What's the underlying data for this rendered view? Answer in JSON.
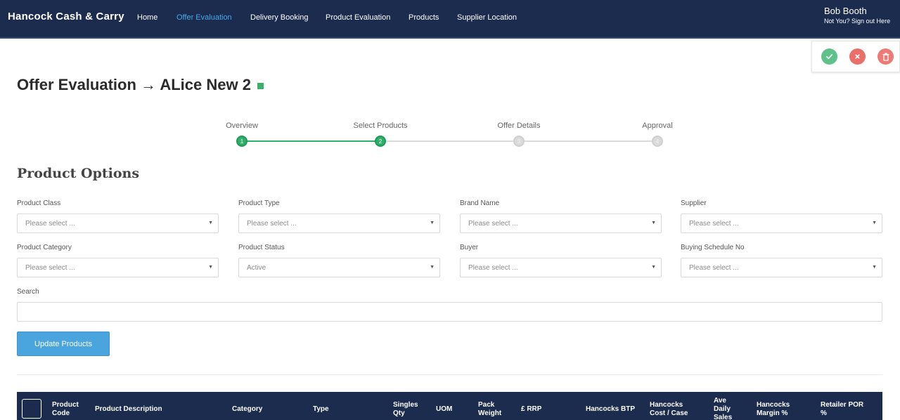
{
  "navbar": {
    "brand": "Hancock Cash & Carry",
    "links": [
      {
        "label": "Home",
        "active": false
      },
      {
        "label": "Offer Evaluation",
        "active": true
      },
      {
        "label": "Delivery Booking",
        "active": false
      },
      {
        "label": "Product Evaluation",
        "active": false
      },
      {
        "label": "Products",
        "active": false
      },
      {
        "label": "Supplier Location",
        "active": false
      }
    ],
    "user_name": "Bob Booth",
    "user_sub": "Not You? Sign out Here"
  },
  "actions": {
    "approve_icon": "check-icon",
    "reject_icon": "close-icon",
    "delete_icon": "trash-icon"
  },
  "page": {
    "title": "Offer Evaluation → ALice New 2"
  },
  "stepper": {
    "steps": [
      {
        "label": "Overview",
        "number": "1",
        "done": true
      },
      {
        "label": "Select Products",
        "number": "2",
        "done": true
      },
      {
        "label": "Offer Details",
        "number": "3",
        "done": false
      },
      {
        "label": "Approval",
        "number": "4",
        "done": false
      }
    ]
  },
  "product_options": {
    "title": "Product Options",
    "filters": [
      {
        "label": "Product Class",
        "value": "Please select ..."
      },
      {
        "label": "Product Type",
        "value": "Please select ..."
      },
      {
        "label": "Brand Name",
        "value": "Please select ..."
      },
      {
        "label": "Supplier",
        "value": "Please select ..."
      },
      {
        "label": "Product Category",
        "value": "Please select ..."
      },
      {
        "label": "Product Status",
        "value": "Active"
      },
      {
        "label": "Buyer",
        "value": "Please select ..."
      },
      {
        "label": "Buying Schedule No",
        "value": "Please select ..."
      }
    ],
    "search_label": "Search",
    "search_value": "",
    "update_button": "Update Products"
  },
  "table": {
    "columns": [
      "Product Code",
      "Product Description",
      "Category",
      "Type",
      "Singles Qty",
      "UOM",
      "Pack Weight",
      "£ RRP",
      "Hancocks BTP",
      "Hancocks Cost / Case",
      "Ave Daily Sales",
      "Hancocks Margin %",
      "Retailer POR %"
    ]
  },
  "colors": {
    "navbar": "#1b2c4f",
    "active_link": "#4aa7e6",
    "step_done": "#2eb06a",
    "step_todo": "#dadada",
    "button": "#4aa5df",
    "approve": "#5fc28a",
    "reject": "#ea6f6a"
  }
}
